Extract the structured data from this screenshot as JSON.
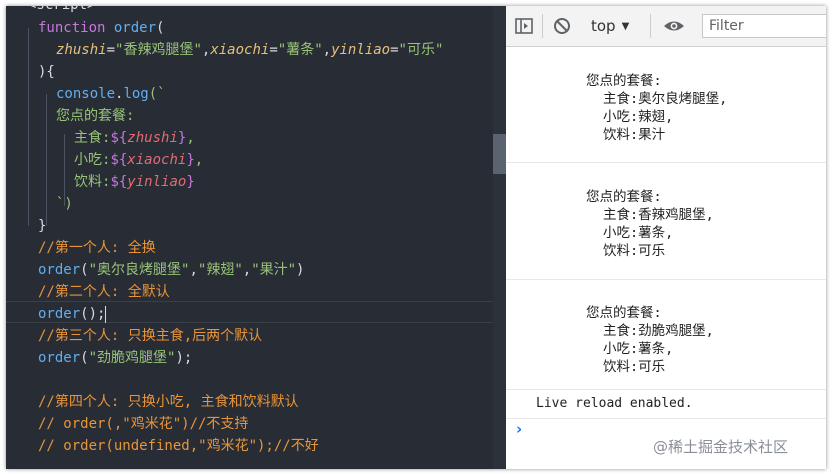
{
  "editor": {
    "top_fragment": "<script>",
    "line1": {
      "keyword": "function",
      "name": "order",
      "paren": "("
    },
    "line2": {
      "p1": "zhushi",
      "eq1": "=",
      "v1": "\"香辣鸡腿堡\"",
      "c1": ",",
      "p2": "xiaochi",
      "eq2": "=",
      "v2": "\"薯条\"",
      "c2": ",",
      "p3": "yinliao",
      "eq3": "=",
      "v3": "\"可乐\""
    },
    "line3": "){",
    "line4": {
      "obj": "console",
      "dot": ".",
      "method": "log",
      "open": "(`"
    },
    "line5": "您点的套餐:",
    "line6": {
      "label": "主食:",
      "open": "${",
      "var": "zhushi",
      "close": "}",
      "tail": ","
    },
    "line7": {
      "label": "小吃:",
      "open": "${",
      "var": "xiaochi",
      "close": "}",
      "tail": ","
    },
    "line8": {
      "label": "饮料:",
      "open": "${",
      "var": "yinliao",
      "close": "}"
    },
    "line9": "`)",
    "line10": "}",
    "line11": "//第一个人: 全换",
    "line12": {
      "fn": "order",
      "open": "(",
      "a1": "\"奥尔良烤腿堡\"",
      "c1": ",",
      "a2": "\"辣翅\"",
      "c2": ",",
      "a3": "\"果汁\"",
      "close": ")"
    },
    "line13": "//第二个人: 全默认",
    "line14": {
      "fn": "order",
      "rest": "();"
    },
    "line15": "//第三个人: 只换主食,后两个默认",
    "line16": {
      "fn": "order",
      "open": "(",
      "a1": "\"劲脆鸡腿堡\"",
      "close": ");"
    },
    "line18": "//第四个人: 只换小吃, 主食和饮料默认",
    "line19": "// order(,\"鸡米花\")//不支持",
    "line20": "// order(undefined,\"鸡米花\");//不好"
  },
  "devtools": {
    "context": "top",
    "filter_placeholder": "Filter",
    "messages": [
      {
        "title": "您点的套餐:",
        "main": "主食:奥尔良烤腿堡,",
        "snack": "小吃:辣翅,",
        "drink": "饮料:果汁"
      },
      {
        "title": "您点的套餐:",
        "main": "主食:香辣鸡腿堡,",
        "snack": "小吃:薯条,",
        "drink": "饮料:可乐"
      },
      {
        "title": "您点的套餐:",
        "main": "主食:劲脆鸡腿堡,",
        "snack": "小吃:薯条,",
        "drink": "饮料:可乐"
      }
    ],
    "reload_message": "Live reload enabled.",
    "prompt_symbol": "›"
  },
  "watermark": "@稀土掘金技术社区",
  "colors": {
    "editor_bg": "#282c34",
    "keyword": "#c678dd",
    "function": "#61afef",
    "param": "#e5c07b",
    "string": "#98c379",
    "comment": "#e8953a",
    "variable": "#e06c75",
    "console_prompt": "#1a73e8"
  }
}
